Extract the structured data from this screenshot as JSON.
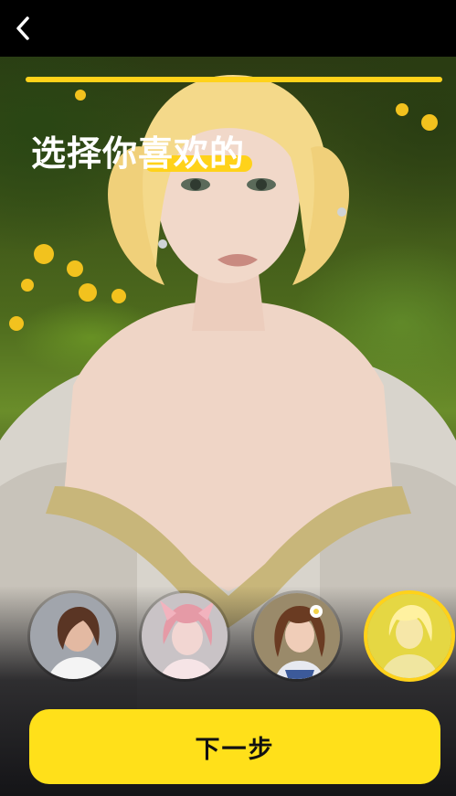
{
  "header": {
    "back_icon": "chevron-left-icon"
  },
  "progress": {
    "value_percent": 100,
    "color": "#ffd21a"
  },
  "headline": {
    "text": "选择你喜欢的",
    "highlight_color": "#ffd21a"
  },
  "characters": [
    {
      "name": "character-1",
      "selected": false
    },
    {
      "name": "character-2",
      "selected": false
    },
    {
      "name": "character-3",
      "selected": false
    },
    {
      "name": "character-4",
      "selected": true
    }
  ],
  "footer": {
    "next_label": "下一步",
    "button_color": "#ffe01a"
  },
  "colors": {
    "accent": "#ffd21a",
    "background": "#000000"
  }
}
